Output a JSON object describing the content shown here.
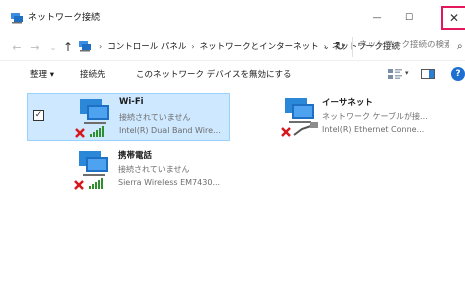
{
  "window": {
    "title": "ネットワーク接続",
    "minimize_glyph": "—",
    "maximize_glyph": "☐",
    "close_glyph": "✕"
  },
  "address_bar": {
    "back_glyph": "←",
    "forward_glyph": "→",
    "recent_glyph": "⌄",
    "up_glyph": "↑",
    "breadcrumb": [
      "コントロール パネル",
      "ネットワークとインターネット",
      "ネットワーク接続"
    ],
    "dropdown_glyph": "⌄",
    "refresh_glyph": "↻",
    "search_placeholder": "ネットワーク接続の検索",
    "search_glyph": "⌕"
  },
  "toolbar": {
    "organize": "整理 ▾",
    "connect_to": "接続先",
    "disable_device": "このネットワーク デバイスを無効にする",
    "view_dropdown_glyph": "▾",
    "help_glyph": "?"
  },
  "connections": [
    {
      "name": "Wi-Fi",
      "status": "接続されていません",
      "device": "Intel(R) Dual Band Wire...",
      "selected": true,
      "checked": true,
      "icon": "wifi-network-icon"
    },
    {
      "name": "イーサネット",
      "status": "ネットワーク ケーブルが接...",
      "device": "Intel(R) Ethernet Conne...",
      "selected": false,
      "icon": "ethernet-network-icon"
    },
    {
      "name": "携帯電話",
      "status": "接続されていません",
      "device": "Sierra Wireless EM7430...",
      "selected": false,
      "icon": "cellular-network-icon"
    }
  ],
  "checkbox_glyph": "✓",
  "colors": {
    "selection_bg": "#cde8ff",
    "selection_border": "#99d1ff",
    "close_highlight": "#e3175a",
    "help_blue": "#1e6fd0",
    "error_red": "#d6181e",
    "signal_green": "#2f8f2f"
  }
}
